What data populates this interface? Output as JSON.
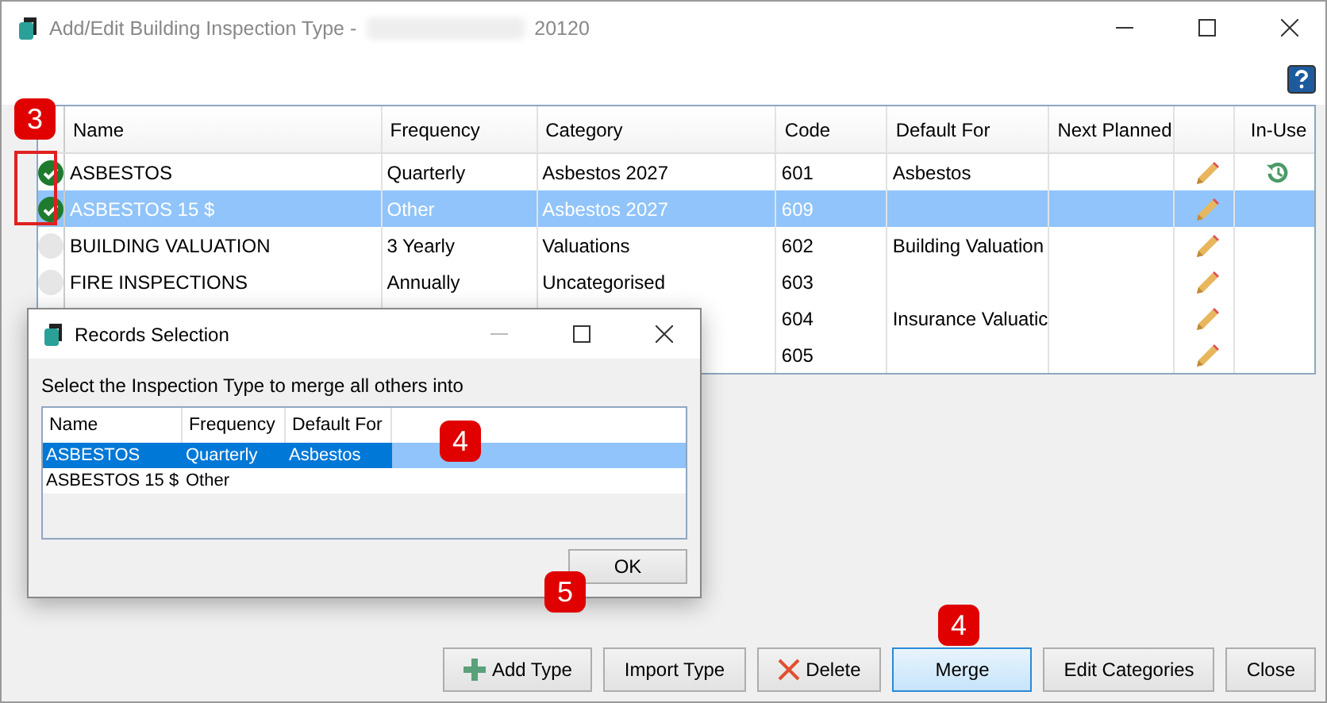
{
  "window": {
    "title": "Add/Edit Building Inspection Type -",
    "title_suffix": "20120"
  },
  "table": {
    "columns": [
      "Name",
      "Frequency",
      "Category",
      "Code",
      "Default For",
      "Next Planned",
      "In-Use"
    ],
    "rows": [
      {
        "checked": true,
        "selected": false,
        "in_use": true,
        "name": "ASBESTOS",
        "frequency": "Quarterly",
        "category": "Asbestos 2027",
        "code": "601",
        "default_for": "Asbestos"
      },
      {
        "checked": true,
        "selected": true,
        "in_use": false,
        "name": "ASBESTOS 15 $",
        "frequency": "Other",
        "category": "Asbestos 2027",
        "code": "609",
        "default_for": ""
      },
      {
        "checked": false,
        "selected": false,
        "in_use": false,
        "name": "BUILDING VALUATION",
        "frequency": "3 Yearly",
        "category": "Valuations",
        "code": "602",
        "default_for": "Building Valuation"
      },
      {
        "checked": false,
        "selected": false,
        "in_use": false,
        "name": "FIRE INSPECTIONS",
        "frequency": "Annually",
        "category": "Uncategorised",
        "code": "603",
        "default_for": ""
      },
      {
        "selected": false,
        "in_use": false,
        "code": "604",
        "default_for": "Insurance Valuatic"
      },
      {
        "selected": false,
        "in_use": false,
        "code": "605",
        "default_for": ""
      }
    ]
  },
  "buttons": [
    {
      "kind": "add",
      "label": "Add Type",
      "focused": false
    },
    {
      "kind": "plain",
      "label": "Import Type",
      "focused": false
    },
    {
      "kind": "delete",
      "label": "Delete",
      "focused": false
    },
    {
      "kind": "plain",
      "label": "Merge",
      "focused": true
    },
    {
      "kind": "plain",
      "label": "Edit Categories",
      "focused": false
    },
    {
      "kind": "plain",
      "label": "Close",
      "focused": false
    }
  ],
  "dialog": {
    "title": "Records Selection",
    "prompt": "Select the Inspection Type to merge all others into",
    "columns": [
      "Name",
      "Frequency",
      "Default For"
    ],
    "rows": [
      {
        "selected": true,
        "cells": [
          "ASBESTOS",
          "Quarterly",
          "Asbestos"
        ]
      },
      {
        "selected": false,
        "cells": [
          "ASBESTOS 15 $",
          "Other",
          ""
        ]
      }
    ],
    "ok": "OK"
  },
  "annotations": [
    "3",
    "4",
    "5",
    "4"
  ]
}
